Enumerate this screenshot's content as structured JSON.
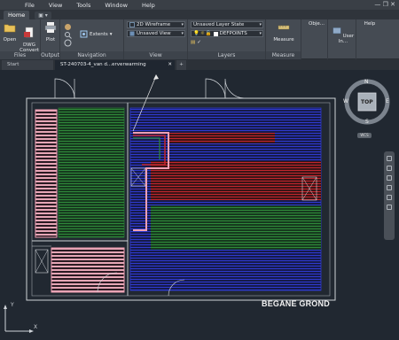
{
  "menu": {
    "items": [
      "File",
      "View",
      "Tools",
      "Window",
      "Help"
    ],
    "window_controls": "—  ❐  ✕"
  },
  "tabs": {
    "home": "Home",
    "extra": "▣ ▾"
  },
  "ribbon": {
    "files": {
      "title": "Files",
      "open": "Open",
      "dwg_convert": "DWG\nConvert"
    },
    "output": {
      "title": "Output",
      "plot": "Plot"
    },
    "navigation": {
      "title": "Navigation",
      "extents": "Extents"
    },
    "view": {
      "title": "View",
      "visual_style": "2D Wireframe",
      "named_view": "Unsaved View"
    },
    "layers": {
      "title": "Layers",
      "layer_state": "Unsaved Layer State",
      "current_layer": "DEFPOINTS"
    },
    "measure": {
      "title": "Measure",
      "label": "Measure"
    },
    "objects": {
      "label": "Obje..."
    },
    "user_interface": {
      "label": "User In..."
    },
    "help": {
      "label": "Help"
    }
  },
  "file_tabs": {
    "start": "Start",
    "active": "ST-240703-4_van d...erverwarming",
    "close": "✕",
    "plus": "+"
  },
  "viewcube": {
    "top": "TOP",
    "n": "N",
    "s": "S",
    "e": "E",
    "w": "W",
    "wcs": "WCS"
  },
  "drawing": {
    "title": "BEGANE GROND",
    "ucs_y": "Y",
    "ucs_x": "X"
  },
  "colors": {
    "pink_loop": "#f0a0b4",
    "green_loop": "#2f8a3a",
    "red_loop": "#b8222a",
    "blue_loop": "#2b35b8",
    "walls": "#cfd3d8"
  }
}
